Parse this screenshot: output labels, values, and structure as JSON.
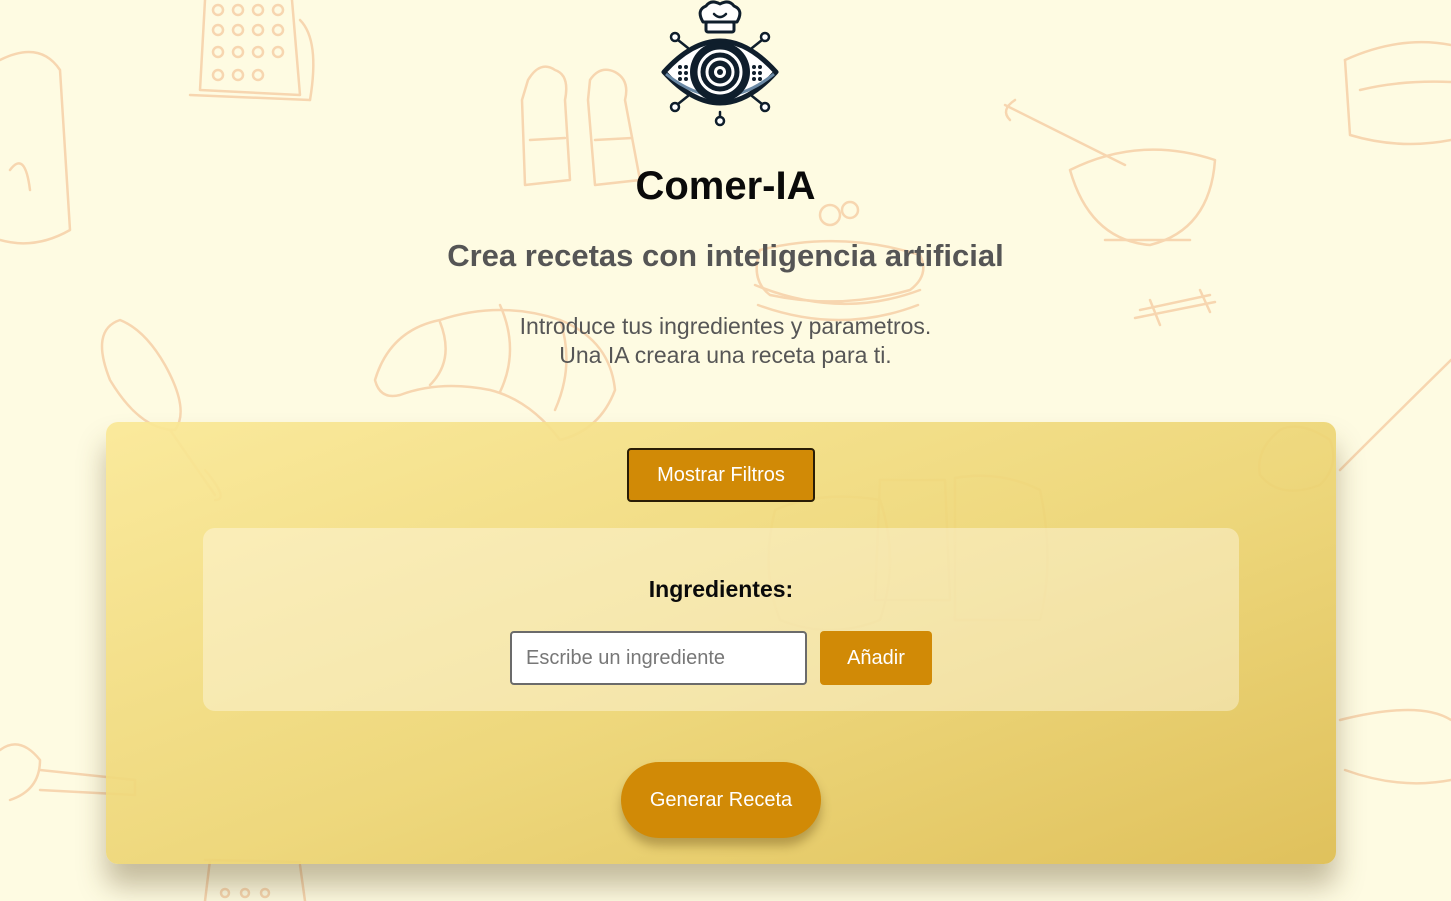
{
  "app": {
    "title": "Comer-IA",
    "subtitle": "Crea recetas con inteligencia artificial",
    "intro_line_1": "Introduce tus ingredientes y parametros.",
    "intro_line_2": "Una IA creara una receta para ti."
  },
  "logo": {
    "icon": "chef-eye-logo-icon"
  },
  "form": {
    "filters_button": "Mostrar Filtros",
    "ingredients_label": "Ingredientes:",
    "ingredient_input": {
      "value": "",
      "placeholder": "Escribe un ingrediente"
    },
    "add_button": "Añadir",
    "generate_button": "Generar Receta"
  },
  "colors": {
    "background": "#fefbe2",
    "accent": "#d18a06",
    "card": "#eed67a",
    "doodle": "#f7d6b0"
  }
}
